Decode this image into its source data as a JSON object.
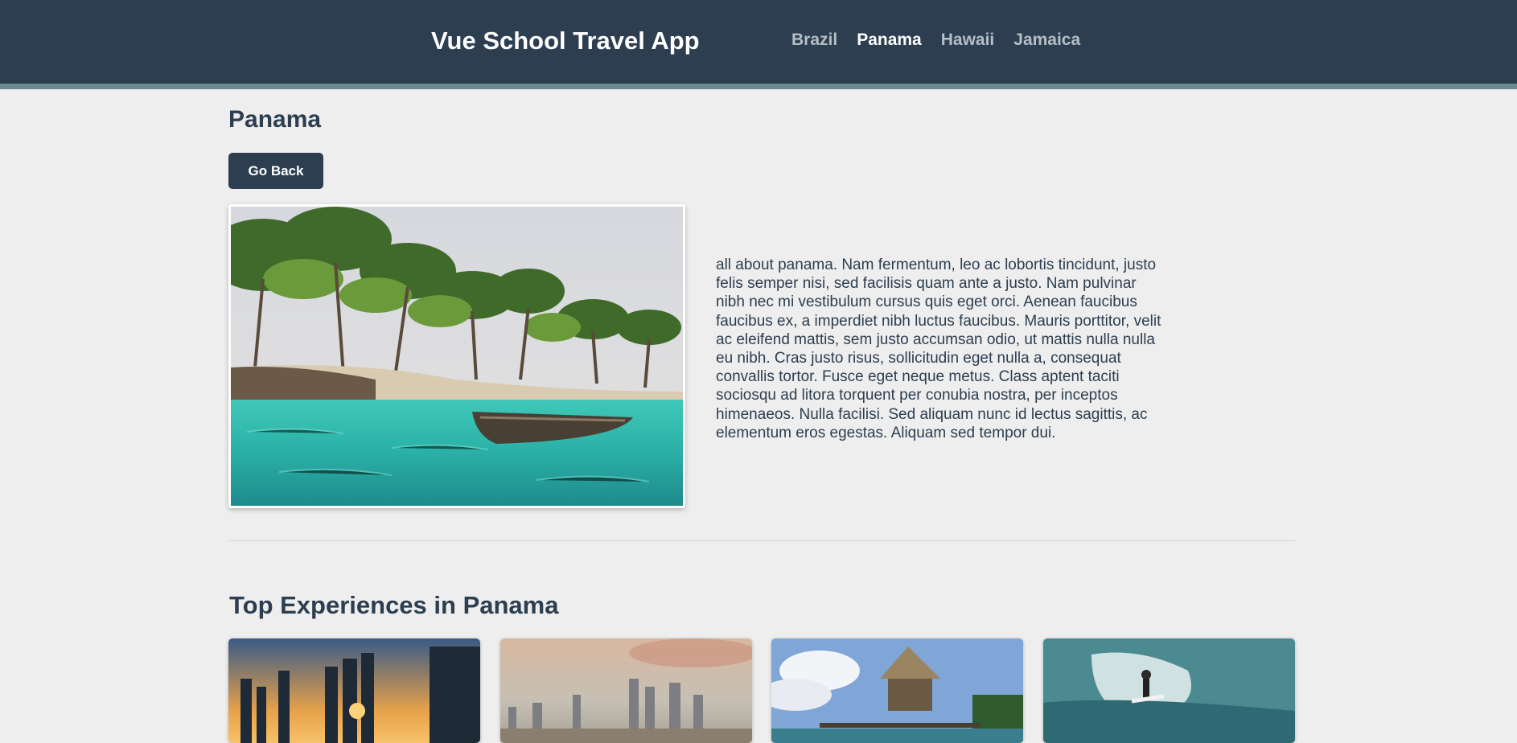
{
  "nav": {
    "brand": "Vue School Travel App",
    "links": [
      {
        "label": "Brazil",
        "active": false
      },
      {
        "label": "Panama",
        "active": true
      },
      {
        "label": "Hawaii",
        "active": false
      },
      {
        "label": "Jamaica",
        "active": false
      }
    ]
  },
  "destination": {
    "title": "Panama",
    "go_back_label": "Go Back",
    "description": "all about panama. Nam fermentum, leo ac lobortis tincidunt, justo felis semper nisi, sed facilisis quam ante a justo. Nam pulvinar nibh nec mi vestibulum cursus quis eget orci. Aenean faucibus faucibus ex, a imperdiet nibh luctus faucibus. Mauris porttitor, velit ac eleifend mattis, sem justo accumsan odio, ut mattis nulla nulla eu nibh. Cras justo risus, sollicitudin eget nulla a, consequat convallis tortor. Fusce eget neque metus. Class aptent taciti sociosqu ad litora torquent per conubia nostra, per inceptos himenaeos. Nulla facilisi. Sed aliquam nunc id lectus sagittis, ac elementum eros egestas. Aliquam sed tempor dui."
  },
  "experiences": {
    "title": "Top Experiences in Panama"
  },
  "colors": {
    "navbar": "#2c3e50",
    "navbar_border": "#6a8a8e",
    "page_bg": "#eeeeee",
    "text": "#2c3e50",
    "nav_inactive": "#b6bec6"
  }
}
